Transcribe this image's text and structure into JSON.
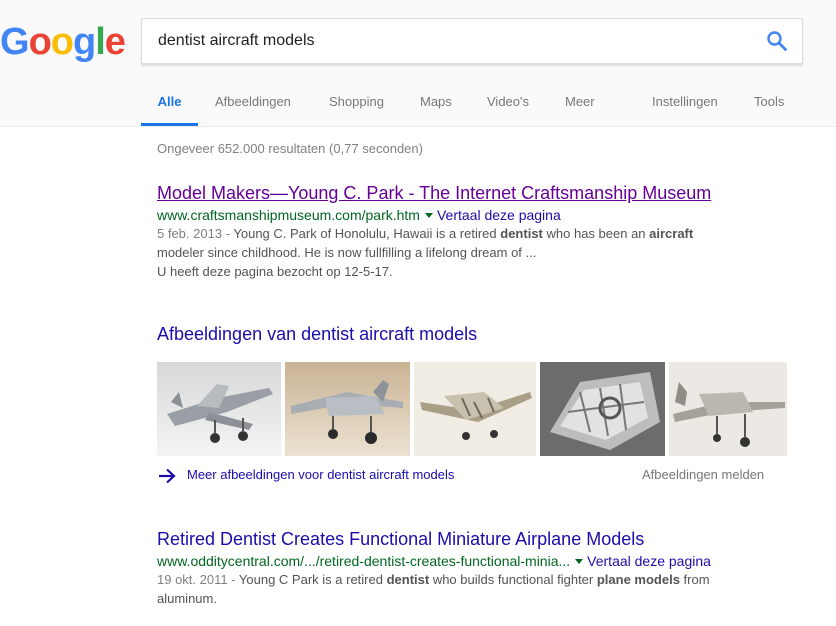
{
  "logo": {
    "letters": [
      "G",
      "o",
      "o",
      "g",
      "l",
      "e"
    ],
    "colors": [
      "#4285F4",
      "#EA4335",
      "#FBBC05",
      "#4285F4",
      "#34A853",
      "#EA4335"
    ]
  },
  "search": {
    "query": "dentist aircraft models",
    "icon": "search-icon"
  },
  "tabs": [
    "Alle",
    "Afbeeldingen",
    "Shopping",
    "Maps",
    "Video's",
    "Meer",
    "Instellingen",
    "Tools"
  ],
  "stats": "Ongeveer 652.000 resultaten (0,77 seconden)",
  "results": [
    {
      "title": "Model Makers—Young C. Park - The Internet Craftsmanship Museum",
      "url": "www.craftsmanshipmuseum.com/park.htm",
      "translate": "Vertaal deze pagina",
      "date": "5 feb. 2013 -",
      "snippet_1a": " Young C. Park of Honolulu, Hawaii is a retired ",
      "snippet_1b": "dentist",
      "snippet_1c": " who has been an ",
      "snippet_1d": "aircraft",
      "snippet_2": "modeler since childhood. He is now fullfilling a lifelong dream of ...",
      "visited": "U heeft deze pagina bezocht op 12-5-17."
    },
    {
      "title": "Retired Dentist Creates Functional Miniature Airplane Models",
      "url": "www.odditycentral.com/.../retired-dentist-creates-functional-minia...",
      "translate": "Vertaal deze pagina",
      "date": "19 okt. 2011 -",
      "snippet_1a": " Young C Park is a retired ",
      "snippet_1b": "dentist",
      "snippet_1c": " who builds functional fighter ",
      "snippet_1d": "plane models",
      "snippet_1e": " from",
      "snippet_2": "aluminum."
    }
  ],
  "images": {
    "heading": "Afbeeldingen van dentist aircraft models",
    "more_link": "Meer afbeeldingen voor dentist aircraft models",
    "report": "Afbeeldingen melden",
    "arrow_icon": "arrow-right-icon"
  }
}
